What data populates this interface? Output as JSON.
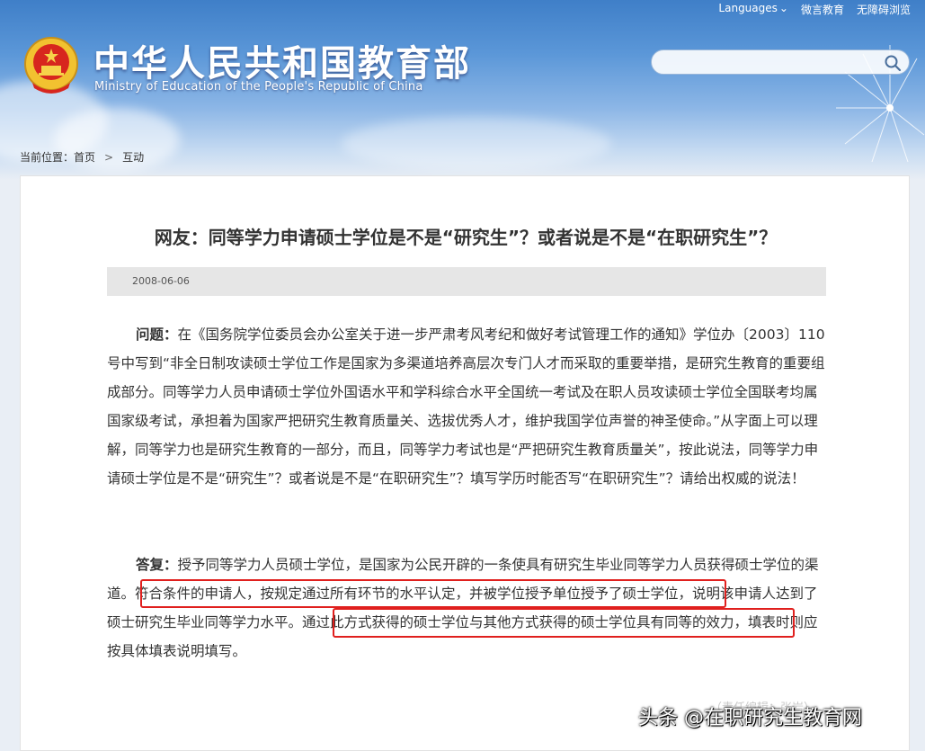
{
  "header": {
    "topbar": [
      "Languages",
      "微言教育",
      "无障碍浏览"
    ],
    "title_cn": "中华人民共和国教育部",
    "title_en": "Ministry of Education of the People's Republic of China",
    "search_placeholder": ""
  },
  "breadcrumb": {
    "prefix": "当前位置：",
    "items": [
      "首页",
      "互动"
    ]
  },
  "article": {
    "title": "网友：同等学力申请硕士学位是不是“研究生”？或者说是不是“在职研究生”？",
    "date": "2008-06-06",
    "question_label": "问题：",
    "question_text": "在《国务院学位委员会办公室关于进一步严肃考风考纪和做好考试管理工作的通知》学位办〔2003〕110号中写到“非全日制攻读硕士学位工作是国家为多渠道培养高层次专门人才而采取的重要举措，是研究生教育的重要组成部分。同等学力人员申请硕士学位外国语水平和学科综合水平全国统一考试及在职人员攻读硕士学位全国联考均属国家级考试，承担着为国家严把研究生教育质量关、选拔优秀人才，维护我国学位声誉的神圣使命。”从字面上可以理解，同等学力也是研究生教育的一部分，而且，同等学力考试也是“严把研究生教育质量关”，按此说法，同等学力申请硕士学位是不是“研究生”？或者说是不是“在职研究生”？填写学历时能否写“在职研究生”？请给出权威的说法！",
    "answer_label": "答复：",
    "answer_text": "授予同等学力人员硕士学位，是国家为公民开辟的一条使具有研究生毕业同等学力人员获得硕士学位的渠道。符合条件的申请人，按规定通过所有环节的水平认定，并被学位授予单位授予了硕士学位，说明该申请人达到了硕士研究生毕业同等学力水平。通过此方式获得的硕士学位与其他方式获得的硕士学位具有同等的效力，填表时则应按具体填表说明填写。"
  },
  "watermark": {
    "text": "头条 @在职研究生教育网",
    "ghost": "（责任编辑：张岩）"
  },
  "colors": {
    "highlight": "#e0201e",
    "header_blue": "#3f7fc8"
  }
}
